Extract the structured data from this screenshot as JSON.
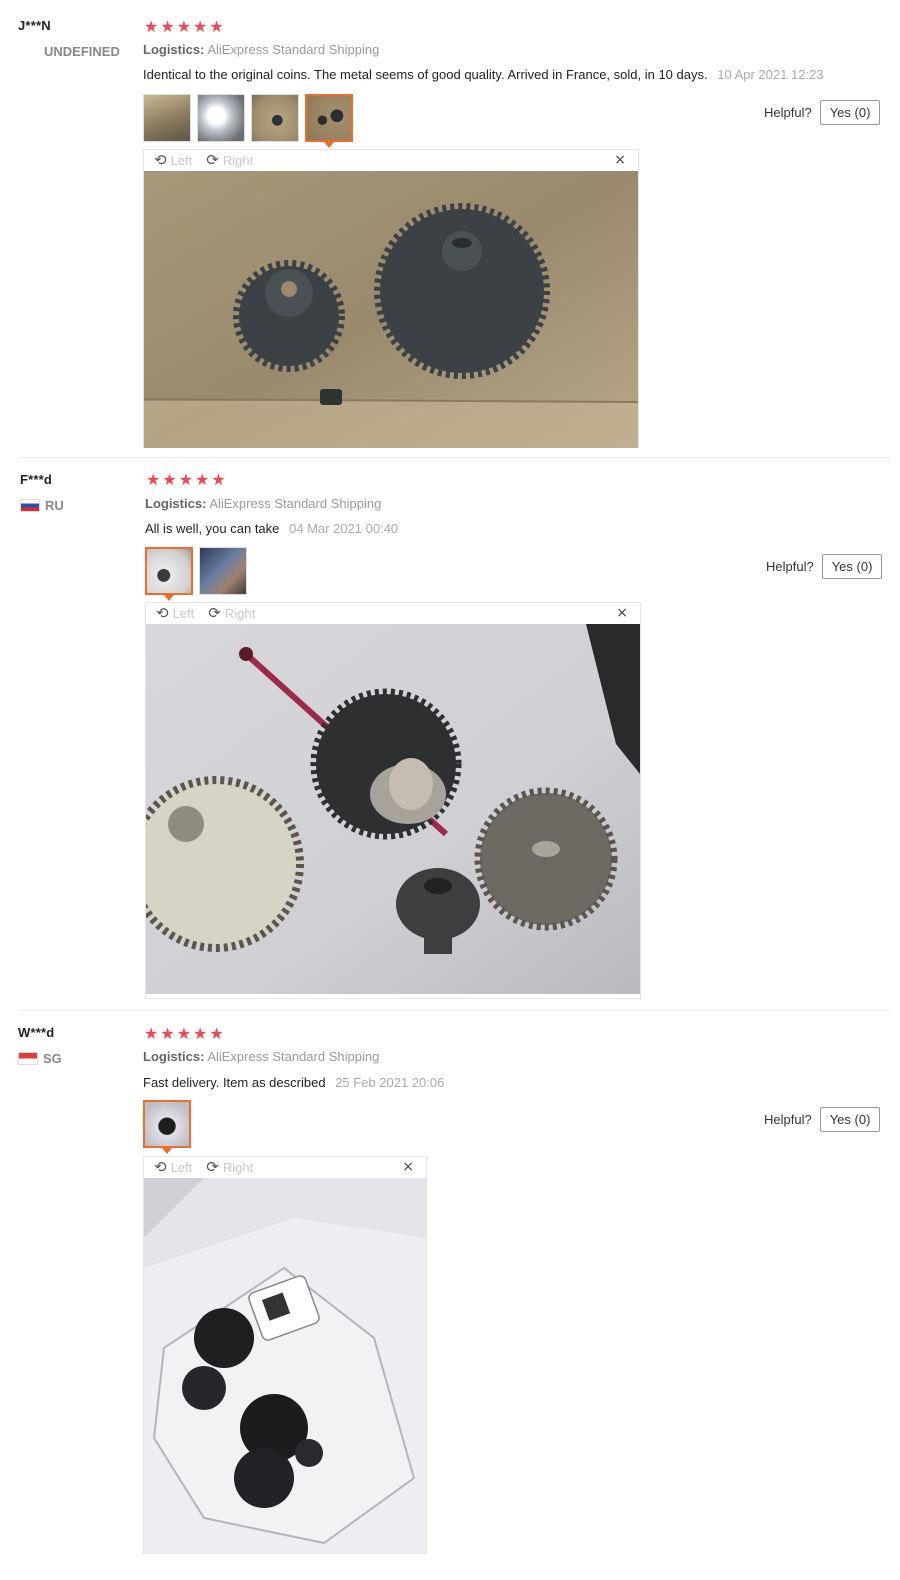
{
  "reviews": [
    {
      "user": "J***N",
      "country": "UNDEFINED",
      "flag": "none",
      "stars": 5,
      "logistics_label": "Logistics:",
      "logistics_value": "AliExpress Standard Shipping",
      "text": "Identical to the original coins. The metal seems of good quality. Arrived in France, sold, in 10 days.",
      "date": "10 Apr 2021 12:23",
      "helpful_label": "Helpful?",
      "yes_label": "Yes (0)",
      "thumb_count": 4,
      "active_thumb": 4
    },
    {
      "user": "F***d",
      "country": "RU",
      "flag": "ru-flag-icon",
      "stars": 5,
      "logistics_label": "Logistics:",
      "logistics_value": "AliExpress Standard Shipping",
      "text": "All is well, you can take",
      "date": "04 Mar 2021 00:40",
      "helpful_label": "Helpful?",
      "yes_label": "Yes (0)",
      "thumb_count": 2,
      "active_thumb": 1
    },
    {
      "user": "W***d",
      "country": "SG",
      "flag": "sg-flag-icon",
      "stars": 5,
      "logistics_label": "Logistics:",
      "logistics_value": "AliExpress Standard Shipping",
      "text": "Fast delivery. Item as described",
      "date": "25 Feb 2021 20:06",
      "helpful_label": "Helpful?",
      "yes_label": "Yes (0)",
      "thumb_count": 1,
      "active_thumb": 1
    }
  ],
  "viewer": {
    "left_label": "Left",
    "right_label": "Right",
    "close_glyph": "×",
    "rotate_left_glyph": "⟲",
    "rotate_right_glyph": "⟳"
  },
  "star_glyph": "★",
  "colors": {
    "star": "#f0494f",
    "active_thumb_border": "#e96f2a",
    "date_text": "#aaaaaa"
  }
}
